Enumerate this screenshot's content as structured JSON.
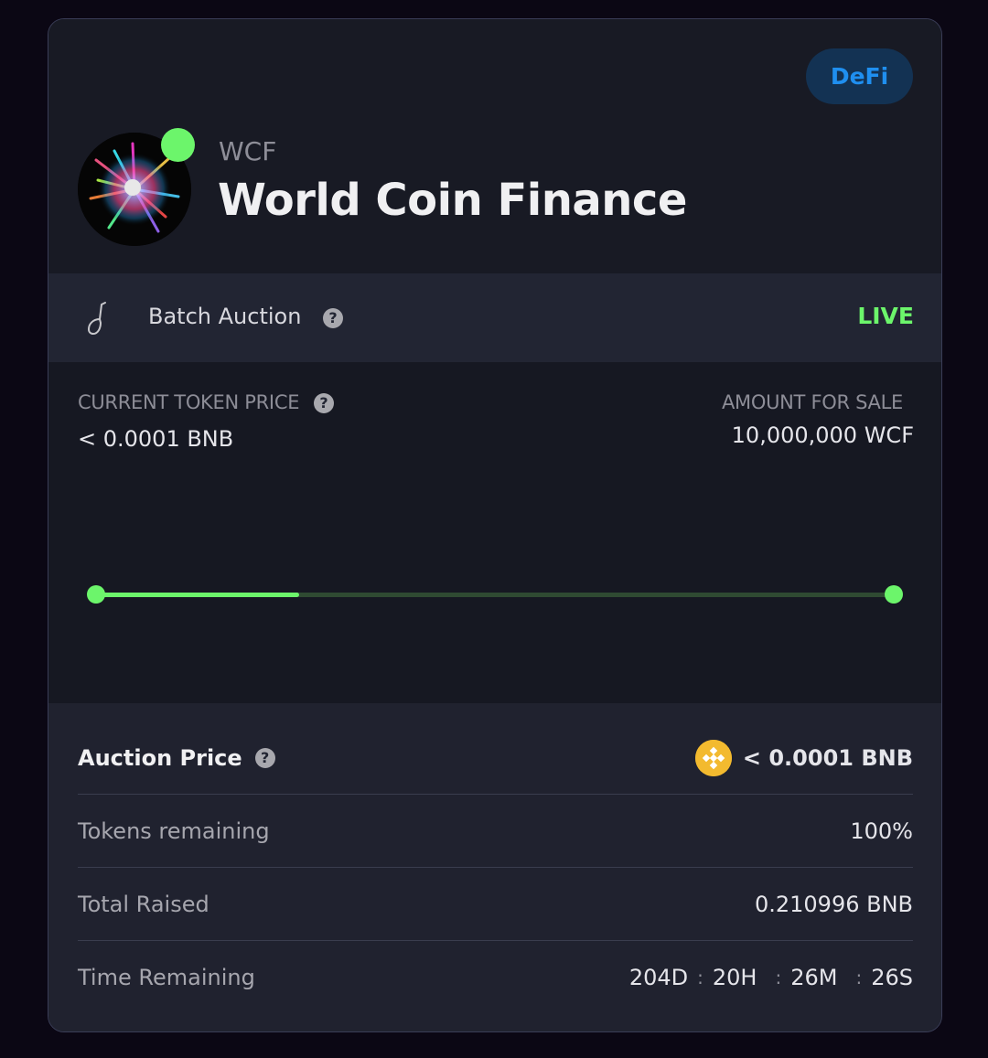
{
  "project": {
    "category": "DeFi",
    "ticker": "WCF",
    "name": "World Coin Finance"
  },
  "auction": {
    "type_label": "Batch Auction",
    "status": "LIVE"
  },
  "pricing": {
    "current_price_label": "CURRENT TOKEN PRICE",
    "current_price_value": "< 0.0001 BNB",
    "amount_for_sale_label": "AMOUNT FOR SALE",
    "amount_for_sale_value": "10,000,000 WCF",
    "progress_fraction": 0.255
  },
  "details": {
    "auction_price_label": "Auction Price",
    "auction_price_value": "< 0.0001 BNB",
    "tokens_remaining_label": "Tokens remaining",
    "tokens_remaining_value": "100%",
    "total_raised_label": "Total Raised",
    "total_raised_value": "0.210996 BNB",
    "time_remaining_label": "Time Remaining",
    "time_remaining": {
      "days": "204D",
      "hours": "20H",
      "minutes": "26M",
      "seconds": "26S",
      "separator": ":"
    }
  },
  "icons": {
    "status_dot": "live-status-dot",
    "help": "help-icon",
    "auction_type": "gavel-icon",
    "currency": "bnb-icon"
  },
  "colors": {
    "accent_green": "#6cf56b",
    "badge_bg": "#133253",
    "badge_text": "#1f8ff0",
    "bnb_yellow": "#f3ba2f"
  }
}
